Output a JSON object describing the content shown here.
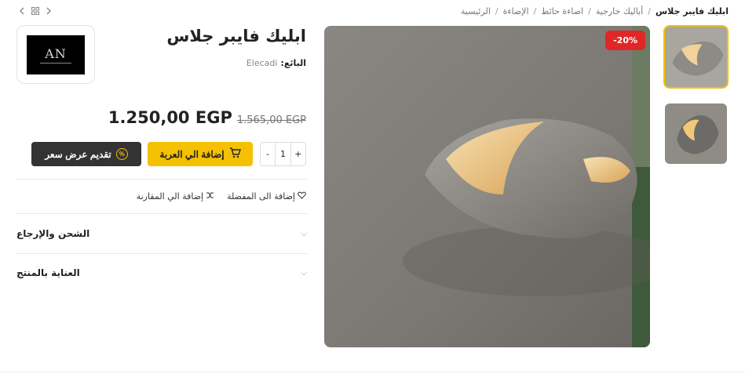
{
  "breadcrumb": {
    "items": [
      "الرئيسية",
      "الإضاءة",
      "اضاءة حائط",
      "أباليك خارجية"
    ],
    "current": "ابليك فايبر جلاس",
    "separator": "/"
  },
  "nav": {
    "grid_icon": "grid-icon",
    "prev_icon": "chevron-left-icon",
    "next_icon": "chevron-right-icon"
  },
  "product": {
    "title": "ابليك فايبر جلاس",
    "seller_label": "البائع:",
    "seller_name": "Elecadi",
    "old_price": "1.565,00 EGP",
    "new_price": "1.250,00 EGP",
    "discount_badge": "-20%"
  },
  "brand": {
    "logo_mark": "AN",
    "logo_icon": "brand-logo"
  },
  "cart": {
    "qty_minus": "-",
    "qty_value": "1",
    "qty_plus": "+",
    "add_to_cart": "إضافة الي العربة",
    "make_offer": "تقديم عرض سعر"
  },
  "actions": {
    "compare": "إضافة الي المقارنة",
    "wishlist": "إضافة الى المفضلة"
  },
  "accordion": {
    "shipping": "الشحن والإرجاع",
    "care": "العناية بالمنتج"
  },
  "colors": {
    "accent": "#f5c000",
    "dark": "#333333",
    "sale": "#e02626"
  }
}
